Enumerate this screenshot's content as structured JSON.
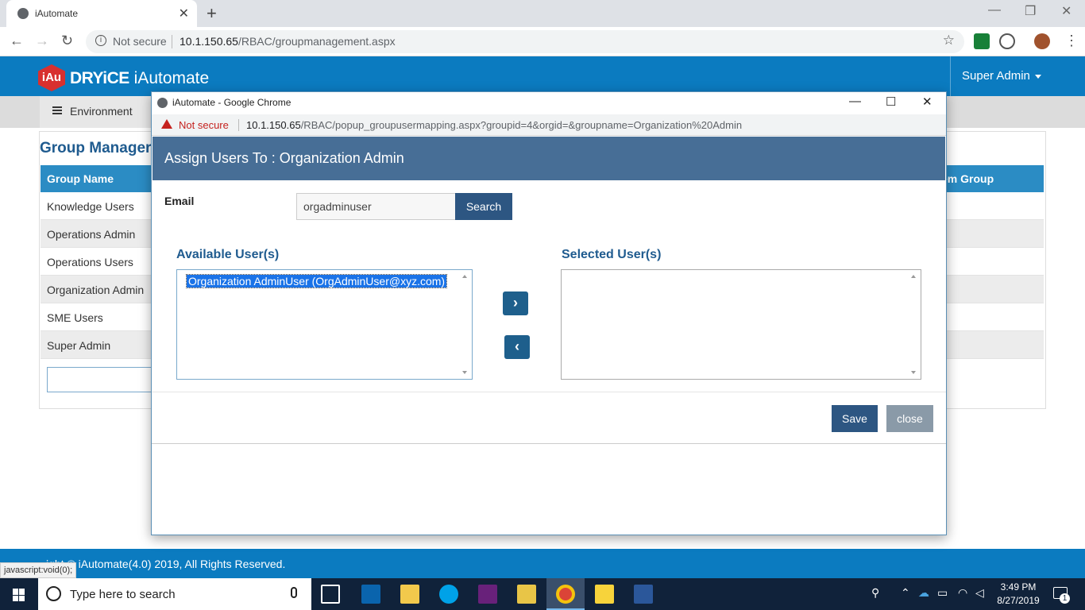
{
  "browser": {
    "tab_title": "iAutomate",
    "security_label": "Not secure",
    "url_host": "10.1.150.65",
    "url_path": "/RBAC/groupmanagement.aspx"
  },
  "app": {
    "brand_badge": "iAu",
    "brand_bold": "DRYiCE",
    "brand_name": "iAutomate",
    "user_menu": "Super Admin",
    "subnav_item": "Environment",
    "page_title": "Group Manager",
    "table": {
      "headers": [
        "Group Name",
        "em Group"
      ],
      "rows": [
        "Knowledge Users",
        "Operations Admin",
        "Operations Users",
        "Organization Admin",
        "SME Users",
        "Super Admin"
      ]
    },
    "footer": "ight © iAutomate(4.0) 2019, All Rights Reserved.",
    "status_url": "javascript:void(0);"
  },
  "popup": {
    "window_title": "iAutomate - Google Chrome",
    "security_label": "Not secure",
    "url_host": "10.1.150.65",
    "url_path": "/RBAC/popup_groupusermapping.aspx?groupid=4&orgid=&groupname=Organization%20Admin",
    "modal_title": "Assign Users To : Organization Admin",
    "email_label": "Email",
    "email_value": "orgadminuser",
    "search_label": "Search",
    "available_label": "Available User(s)",
    "selected_label": "Selected User(s)",
    "available_users": [
      "Organization AdminUser (OrgAdminUser@xyz.com)"
    ],
    "add_arrow": "›",
    "remove_arrow": "‹",
    "save_label": "Save",
    "close_label": "close"
  },
  "taskbar": {
    "search_placeholder": "Type here to search",
    "time": "3:49 PM",
    "date": "8/27/2019",
    "notification_count": "1"
  },
  "colors": {
    "header_blue": "#0b7bc0",
    "modal_header": "#476e96",
    "primary_button": "#2d5682",
    "table_header": "#2b8cc4"
  }
}
